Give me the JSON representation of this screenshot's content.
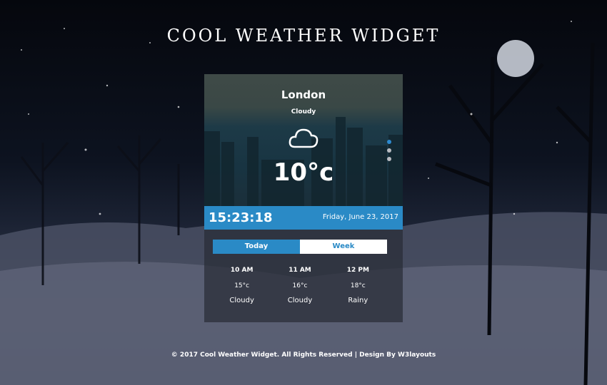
{
  "page": {
    "title": "COOL WEATHER WIDGET",
    "footer": "© 2017 Cool Weather Widget. All Rights Reserved | Design By W3layouts"
  },
  "widget": {
    "city": "London",
    "condition": "Cloudy",
    "condition_icon": "cloud-icon",
    "temperature": "10°c",
    "carousel": {
      "total": 3,
      "active_index": 0
    },
    "clock": "15:23:18",
    "date": "Friday, June 23, 2017",
    "tabs": [
      {
        "label": "Today",
        "active": true
      },
      {
        "label": "Week",
        "active": false
      }
    ],
    "forecast": [
      {
        "time": "10 AM",
        "temp": "15°c",
        "condition": "Cloudy"
      },
      {
        "time": "11 AM",
        "temp": "16°c",
        "condition": "Cloudy"
      },
      {
        "time": "12 PM",
        "temp": "18°c",
        "condition": "Rainy"
      }
    ]
  },
  "colors": {
    "accent": "#2a8ac6",
    "tab_inactive_bg": "#ffffff",
    "panel_bg": "#282c36"
  }
}
